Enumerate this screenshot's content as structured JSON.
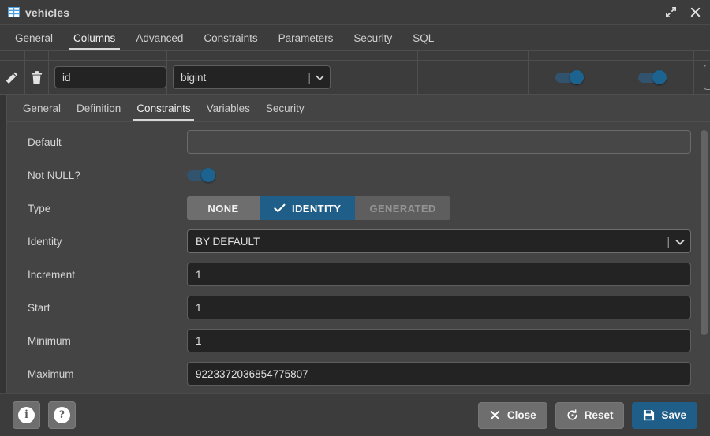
{
  "window": {
    "title": "vehicles",
    "icon": "table-icon",
    "maximize_icon": "expand-icon",
    "close_icon": "close-icon"
  },
  "outer_tabs": [
    {
      "label": "General",
      "active": false
    },
    {
      "label": "Columns",
      "active": true
    },
    {
      "label": "Advanced",
      "active": false
    },
    {
      "label": "Constraints",
      "active": false
    },
    {
      "label": "Parameters",
      "active": false
    },
    {
      "label": "Security",
      "active": false
    },
    {
      "label": "SQL",
      "active": false
    }
  ],
  "columns_grid": {
    "row": {
      "edit_icon": "pencil-icon",
      "delete_icon": "trash-icon",
      "name": "id",
      "data_type": "bigint",
      "type_chevron": "chevron-down-icon",
      "toggle_1": "on",
      "toggle_2": "on",
      "last_value": ""
    }
  },
  "inner_tabs": [
    {
      "label": "General",
      "active": false
    },
    {
      "label": "Definition",
      "active": false
    },
    {
      "label": "Constraints",
      "active": true
    },
    {
      "label": "Variables",
      "active": false
    },
    {
      "label": "Security",
      "active": false
    }
  ],
  "form": {
    "default": {
      "label": "Default",
      "value": ""
    },
    "not_null": {
      "label": "Not NULL?",
      "state": "on"
    },
    "type": {
      "label": "Type",
      "options": [
        {
          "label": "NONE",
          "state": "normal"
        },
        {
          "label": "IDENTITY",
          "state": "selected",
          "icon": "check-icon"
        },
        {
          "label": "GENERATED",
          "state": "disabled"
        }
      ]
    },
    "identity": {
      "label": "Identity",
      "value": "BY DEFAULT",
      "chevron": "chevron-down-icon"
    },
    "increment": {
      "label": "Increment",
      "value": "1"
    },
    "start": {
      "label": "Start",
      "value": "1"
    },
    "minimum": {
      "label": "Minimum",
      "value": "1"
    },
    "maximum": {
      "label": "Maximum",
      "value": "9223372036854775807"
    }
  },
  "footer": {
    "info_icon": "info-icon",
    "help_icon": "help-icon",
    "close": {
      "label": "Close",
      "icon": "close-icon"
    },
    "reset": {
      "label": "Reset",
      "icon": "reset-icon"
    },
    "save": {
      "label": "Save",
      "icon": "save-icon"
    }
  },
  "colors": {
    "accent": "#1f5e89",
    "toggle_on_track": "#31536e",
    "toggle_on_knob": "#1d638f",
    "window_bg": "#3c3c3c",
    "panel_bg": "#444444",
    "input_bg": "#232323",
    "text": "#d6d6d6"
  }
}
